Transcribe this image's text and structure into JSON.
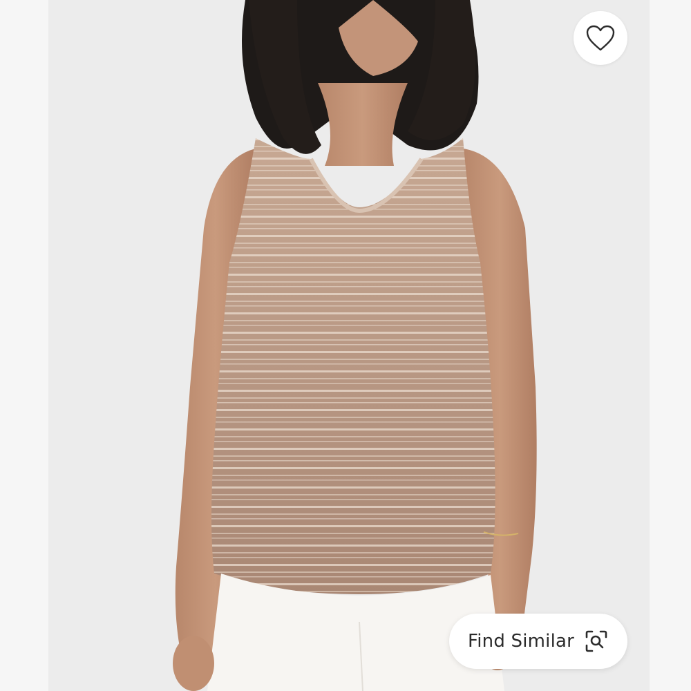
{
  "actions": {
    "find_similar_label": "Find Similar",
    "like_icon": "heart-outline-icon",
    "scan_icon": "visual-search-scan-icon"
  },
  "colors": {
    "background": "#f2f2f2",
    "button_bg": "#ffffff",
    "button_text": "#2b2b2b",
    "garment": "#b08f7c"
  }
}
